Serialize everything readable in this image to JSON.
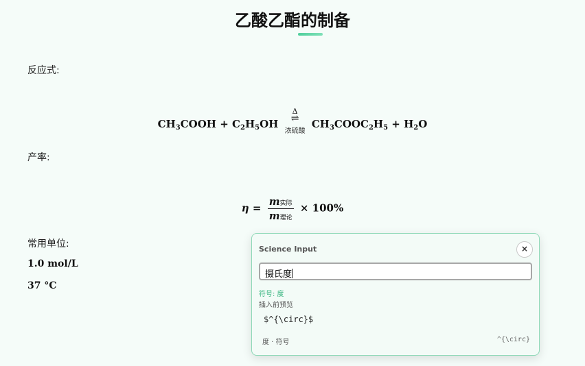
{
  "page": {
    "title": "乙酸乙酯的制备",
    "reaction_label": "反应式:",
    "yield_label": "产率:",
    "units_label": "常用单位:",
    "unit_values": [
      "1.0 mol/L",
      "37 °C"
    ]
  },
  "reaction": {
    "reactant1": {
      "pre": "CH",
      "sub1": "3",
      "mid": "COOH"
    },
    "plus": "+",
    "reactant2": {
      "a": "C",
      "sub1": "2",
      "b": "H",
      "sub2": "5",
      "c": "OH"
    },
    "condition_top": "Δ",
    "arrow": "⇌",
    "condition_bottom": "浓硫酸",
    "product1": {
      "a": "CH",
      "sub1": "3",
      "b": "COOC",
      "sub2": "2",
      "c": "H",
      "sub3": "5"
    },
    "product2": {
      "a": "H",
      "sub1": "2",
      "b": "O"
    }
  },
  "yield_formula": {
    "symbol": "η",
    "equals": "=",
    "numerator_var": "m",
    "numerator_sub": "实际",
    "denominator_var": "m",
    "denominator_sub": "理论",
    "times": "×",
    "percent": "100%"
  },
  "popup": {
    "title": "Science Input",
    "close_icon": "close-icon",
    "close_glyph": "×",
    "input_value": "摄氏度",
    "symbol_line": "符号: 度",
    "preview_label": "插入前预览",
    "preview_code": "$^{\\circ}$",
    "footer_left": "度 · 符号",
    "footer_right": "^{\\circ}"
  },
  "colors": {
    "accent": "#4fcf9c",
    "background": "#f5fcf9",
    "popup_border": "#8fd9b8",
    "symbol_text": "#2fb27a"
  }
}
